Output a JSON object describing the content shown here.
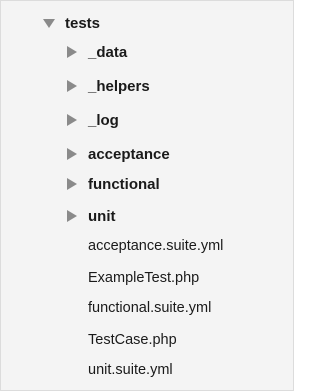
{
  "tree": {
    "root": {
      "label": "tests",
      "expanded": true,
      "icon": "triangle-down-icon"
    },
    "folders": [
      {
        "label": "_data",
        "icon": "triangle-right-icon"
      },
      {
        "label": "_helpers",
        "icon": "triangle-right-icon"
      },
      {
        "label": "_log",
        "icon": "triangle-right-icon"
      },
      {
        "label": "acceptance",
        "icon": "triangle-right-icon"
      },
      {
        "label": "functional",
        "icon": "triangle-right-icon"
      },
      {
        "label": "unit",
        "icon": "triangle-right-icon"
      }
    ],
    "files": [
      {
        "label": "acceptance.suite.yml"
      },
      {
        "label": "ExampleTest.php"
      },
      {
        "label": "functional.suite.yml"
      },
      {
        "label": "TestCase.php"
      },
      {
        "label": "unit.suite.yml"
      }
    ]
  },
  "colors": {
    "panel_bg": "#f4f4f4",
    "text": "#1a1a1a",
    "triangle": "#8a8a8a"
  }
}
